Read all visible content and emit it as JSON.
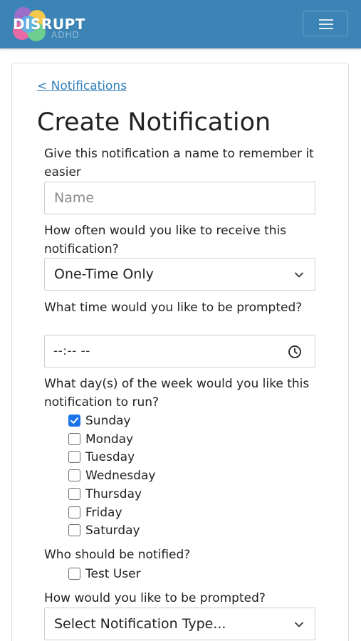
{
  "navbar": {
    "logo_text": "DISRUPT",
    "logo_sub": "ADHD",
    "brand_color": "#3b84b5",
    "menu_icon": "hamburger-icon"
  },
  "page": {
    "back_link": "< Notifications",
    "title": "Create Notification"
  },
  "form": {
    "name": {
      "label": "Give this notification a name to remember it easier",
      "placeholder": "Name",
      "value": ""
    },
    "frequency": {
      "label": "How often would you like to receive this notification?",
      "selected": "One-Time Only",
      "icon": "chevron-down-icon"
    },
    "time": {
      "label": "What time would you like to be prompted?",
      "value": "--:-- --",
      "icon": "clock-icon"
    },
    "days": {
      "label": "What day(s) of the week would you like this notification to run?",
      "options": [
        {
          "label": "Sunday",
          "checked": true
        },
        {
          "label": "Monday",
          "checked": false
        },
        {
          "label": "Tuesday",
          "checked": false
        },
        {
          "label": "Wednesday",
          "checked": false
        },
        {
          "label": "Thursday",
          "checked": false
        },
        {
          "label": "Friday",
          "checked": false
        },
        {
          "label": "Saturday",
          "checked": false
        }
      ]
    },
    "recipients": {
      "label": "Who should be notified?",
      "options": [
        {
          "label": "Test User",
          "checked": false
        }
      ]
    },
    "prompt_type": {
      "label": "How would you like to be prompted?",
      "selected": "Select Notification Type...",
      "icon": "chevron-down-icon"
    }
  },
  "colors": {
    "link": "#2f7fb8",
    "checkbox_checked": "#1a73e8"
  }
}
